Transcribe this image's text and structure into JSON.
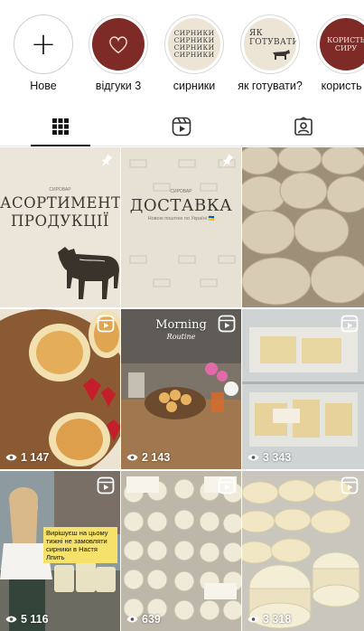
{
  "highlights": [
    {
      "label": "Нове",
      "kind": "new"
    },
    {
      "label": "відгуки 3",
      "kind": "heart"
    },
    {
      "label": "сирники",
      "kind": "text",
      "cover_text": "СИРНИКИ\nСИРНИКИ\nСИРНИКИ\nСИРНИКИ"
    },
    {
      "label": "як готувати?",
      "kind": "text-cow",
      "cover_text": "ЯК\nГОТУВАТИ?"
    },
    {
      "label": "користь с",
      "kind": "red-text",
      "cover_text": "КОРИСТЬ\nСИРУ"
    }
  ],
  "tabs": [
    {
      "name": "posts",
      "icon": "grid-icon",
      "active": true
    },
    {
      "name": "reels",
      "icon": "reels-icon",
      "active": false
    },
    {
      "name": "tagged",
      "icon": "tagged-icon",
      "active": false
    }
  ],
  "posts": [
    {
      "type": "pinned",
      "title_line1": "АСОРТИМЕНТ",
      "title_line2": "ПРОДУКЦІЇ",
      "brand": "СИРОВАР"
    },
    {
      "type": "pinned",
      "title": "ДОСТАВКА",
      "subtitle": "Новою поштою по Україні 🇺🇦",
      "brand": "СИРОВАР"
    },
    {
      "type": "photo",
      "desc": "cheese-rounds"
    },
    {
      "type": "reel",
      "views": "1 147"
    },
    {
      "type": "reel",
      "views": "2 143",
      "overlay_title": "Morning",
      "overlay_sub": "Routine"
    },
    {
      "type": "reel",
      "views": "3 343"
    },
    {
      "type": "reel",
      "views": "5 116",
      "banner": "Вирішуєш на цьому тижні не замовляти сирники в Настя Лпить"
    },
    {
      "type": "reel",
      "views": "639"
    },
    {
      "type": "reel",
      "views": "3 318"
    }
  ],
  "colors": {
    "accent_red": "#7e2a26",
    "paper": "#ece6da",
    "text": "#111111"
  }
}
